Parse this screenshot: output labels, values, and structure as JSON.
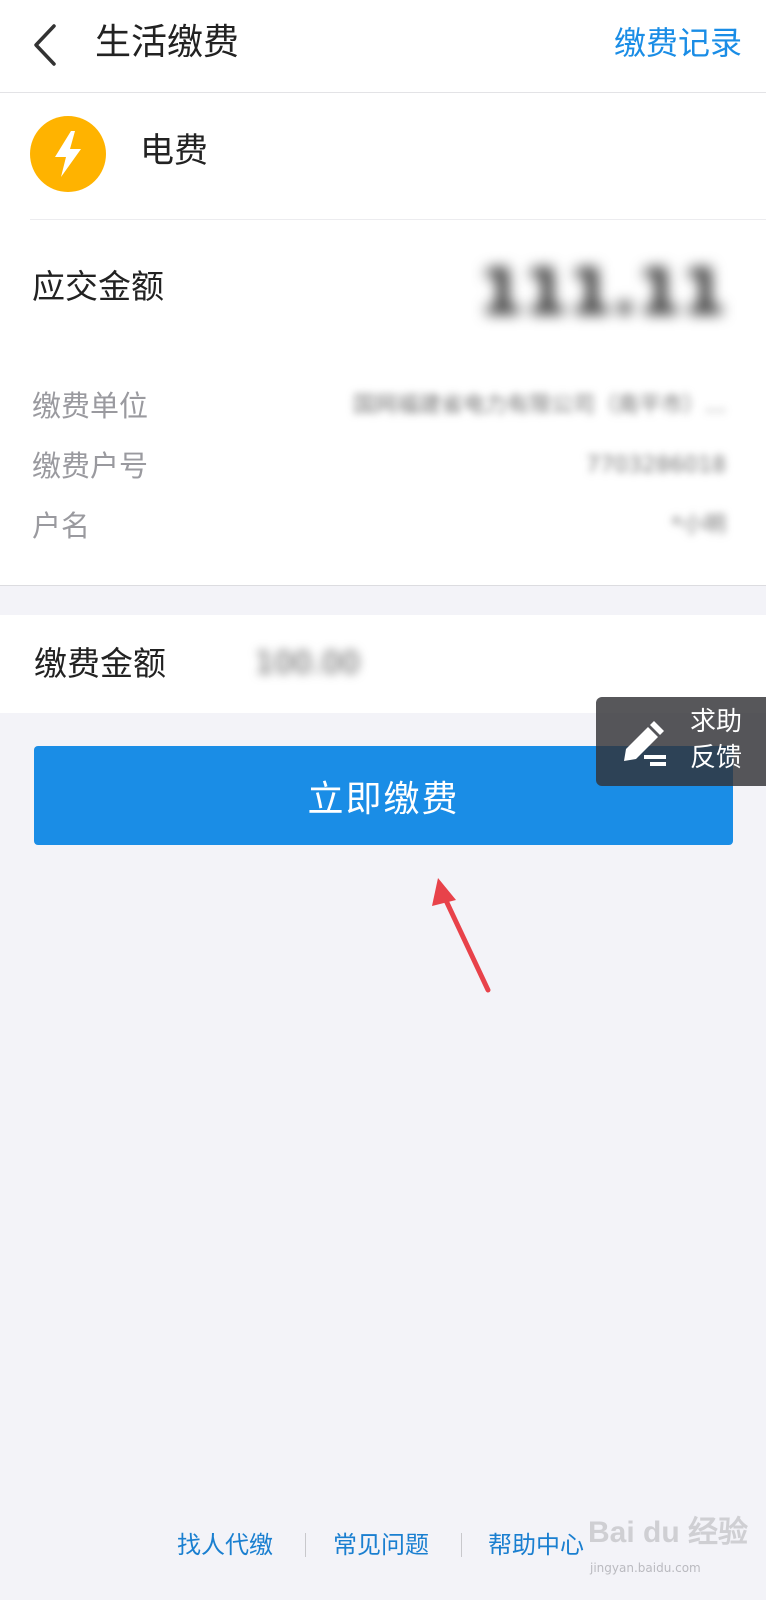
{
  "header": {
    "title": "生活缴费",
    "records_link": "缴费记录"
  },
  "bill": {
    "name": "电费",
    "icon": "lightning-icon",
    "icon_color": "#ffb300",
    "due_label": "应交金额",
    "due_amount": "111.11",
    "rows": [
      {
        "label": "缴费单位",
        "value": "国网福建省电力有限公司（南平市）..."
      },
      {
        "label": "缴费户号",
        "value": "7703286018"
      },
      {
        "label": "户名",
        "value": "*小明"
      }
    ]
  },
  "payment": {
    "label": "缴费金额",
    "value": "100.00",
    "button_label": "立即缴费"
  },
  "float_help": {
    "line1": "求助",
    "line2": "反馈"
  },
  "footer": {
    "links": [
      "找人代缴",
      "常见问题",
      "帮助中心"
    ]
  },
  "watermark": {
    "logo": "Bai du 经验",
    "url": "jingyan.baidu.com"
  },
  "colors": {
    "accent": "#1a8de6",
    "annotation": "#e8424a"
  }
}
